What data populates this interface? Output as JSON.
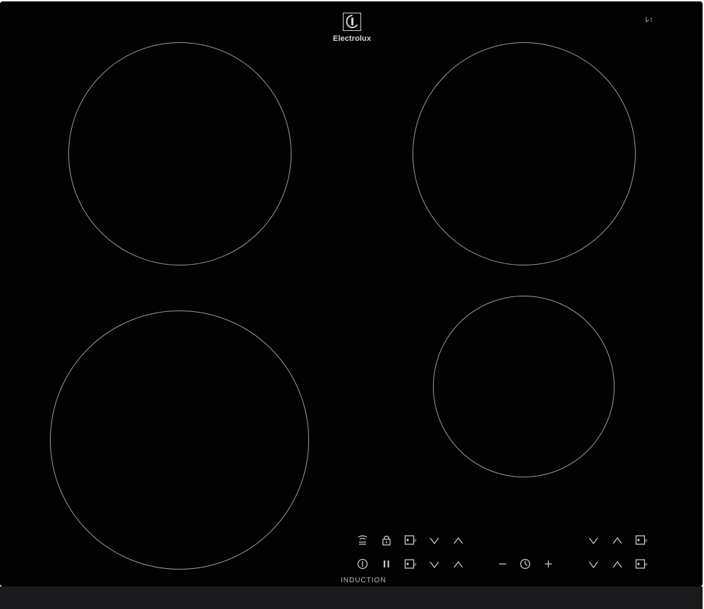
{
  "brand": {
    "name": "Electrolux",
    "icon": "electrolux-logo-icon"
  },
  "panel": {
    "label": "INDUCTION"
  },
  "controls": {
    "row1": [
      "hob-to-hood-icon",
      "lock-icon",
      "power-boost-icon",
      "chevron-down-icon",
      "chevron-up-icon",
      "chevron-down-icon",
      "chevron-up-icon",
      "power-boost-icon"
    ],
    "row2": [
      "power-icon",
      "pause-icon",
      "power-boost-icon",
      "chevron-down-icon",
      "chevron-up-icon",
      "minus-icon",
      "timer-icon",
      "plus-icon",
      "chevron-down-icon",
      "chevron-up-icon",
      "power-boost-icon"
    ]
  },
  "colors": {
    "glass": "#020203",
    "zone_outline": "#9a9a9a",
    "symbols": "#c8c8c8"
  }
}
